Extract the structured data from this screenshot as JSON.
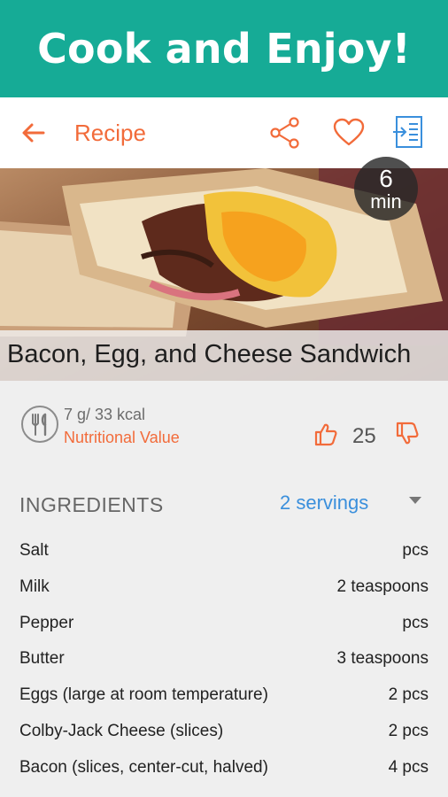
{
  "banner": {
    "title": "Cook and Enjoy!"
  },
  "appbar": {
    "title": "Recipe",
    "icons": [
      "back-arrow-icon",
      "share-icon",
      "heart-icon",
      "list-export-icon"
    ]
  },
  "recipe": {
    "name": "Bacon, Egg, and Cheese Sandwich",
    "time_value": "6",
    "time_unit": "min"
  },
  "nutrition": {
    "macro": "7 g/ 33 kcal",
    "link": "Nutritional Value"
  },
  "votes": {
    "count": "25"
  },
  "ingredients": {
    "label": "INGREDIENTS",
    "servings": "2 servings",
    "items": [
      {
        "name": "Salt",
        "qty": "pcs"
      },
      {
        "name": "Milk",
        "qty": "2 teaspoons"
      },
      {
        "name": "Pepper",
        "qty": "pcs"
      },
      {
        "name": "Butter",
        "qty": "3 teaspoons"
      },
      {
        "name": "Eggs (large at room temperature)",
        "qty": "2 pcs"
      },
      {
        "name": "Colby-Jack Cheese (slices)",
        "qty": "2 pcs"
      },
      {
        "name": "Bacon (slices, center-cut, halved)",
        "qty": "4 pcs"
      }
    ]
  },
  "colors": {
    "brand": "#16ab96",
    "accent": "#f26b3a",
    "link": "#3a8fdc"
  }
}
